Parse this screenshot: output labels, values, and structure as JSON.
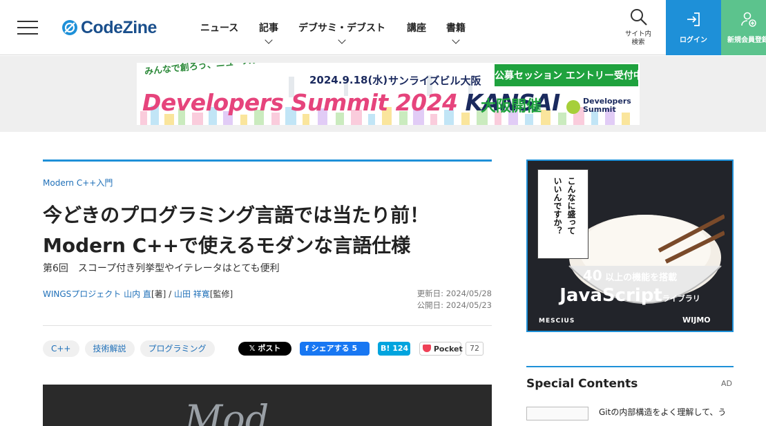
{
  "header": {
    "logo_text": "CodeZine",
    "nav": [
      {
        "label": "ニュース"
      },
      {
        "label": "記事"
      },
      {
        "label": "デブサミ・デブスト"
      },
      {
        "label": "講座"
      },
      {
        "label": "書籍"
      }
    ],
    "search_label": "サイト内\n検索",
    "login_label": "ログイン",
    "signup_label": "新規会員登録",
    "colors": {
      "login": "#1e90d8",
      "signup": "#5cc38d"
    }
  },
  "banner": {
    "tagline": "みんなで創ろう、ニュースタンダード",
    "date": "2024.9.18(水)",
    "venue": "サンライズビル大阪",
    "cta": "公募セッション エントリー受付中！",
    "title_main": "Developers Summit 2024 ",
    "title_kansai": "KANSAI",
    "osaka": "大阪開催",
    "logo": "Developers\nSummit"
  },
  "article": {
    "series": "Modern C++入門",
    "title": "今どきのプログラミング言語では当たり前！Modern C++で使えるモダンな言語仕様",
    "subtitle": "第6回　スコープ付き列挙型やイテレータはとても便利",
    "authors": {
      "org_author": "WINGSプロジェクト 山内 直",
      "role1": "[著] / ",
      "supervisor": "山田 祥寛",
      "role2": "[監修]"
    },
    "updated": "更新日: 2024/05/28",
    "published": "公開日: 2024/05/23",
    "tags": [
      "C++",
      "技術解説",
      "プログラミング"
    ],
    "share": {
      "x": "𝕏 ポスト",
      "facebook": "f シェアする 5",
      "hatena": "B! 124",
      "pocket": "Pocket",
      "pocket_count": "72"
    },
    "hero_word": "Mod"
  },
  "sidebar": {
    "ad": {
      "vertical_1": "こんなに盛って",
      "vertical_2": "いいんですか？",
      "features_num": "40",
      "features_text": "以上の機能を搭載",
      "js": "JavaScript",
      "js_suffix": "ライブラリ",
      "brand": "MESCIUS",
      "product": "WIJMO"
    },
    "special_title": "Special Contents",
    "special_ad": "AD",
    "special_item": "Gitの内部構造をよく理解して、う"
  }
}
